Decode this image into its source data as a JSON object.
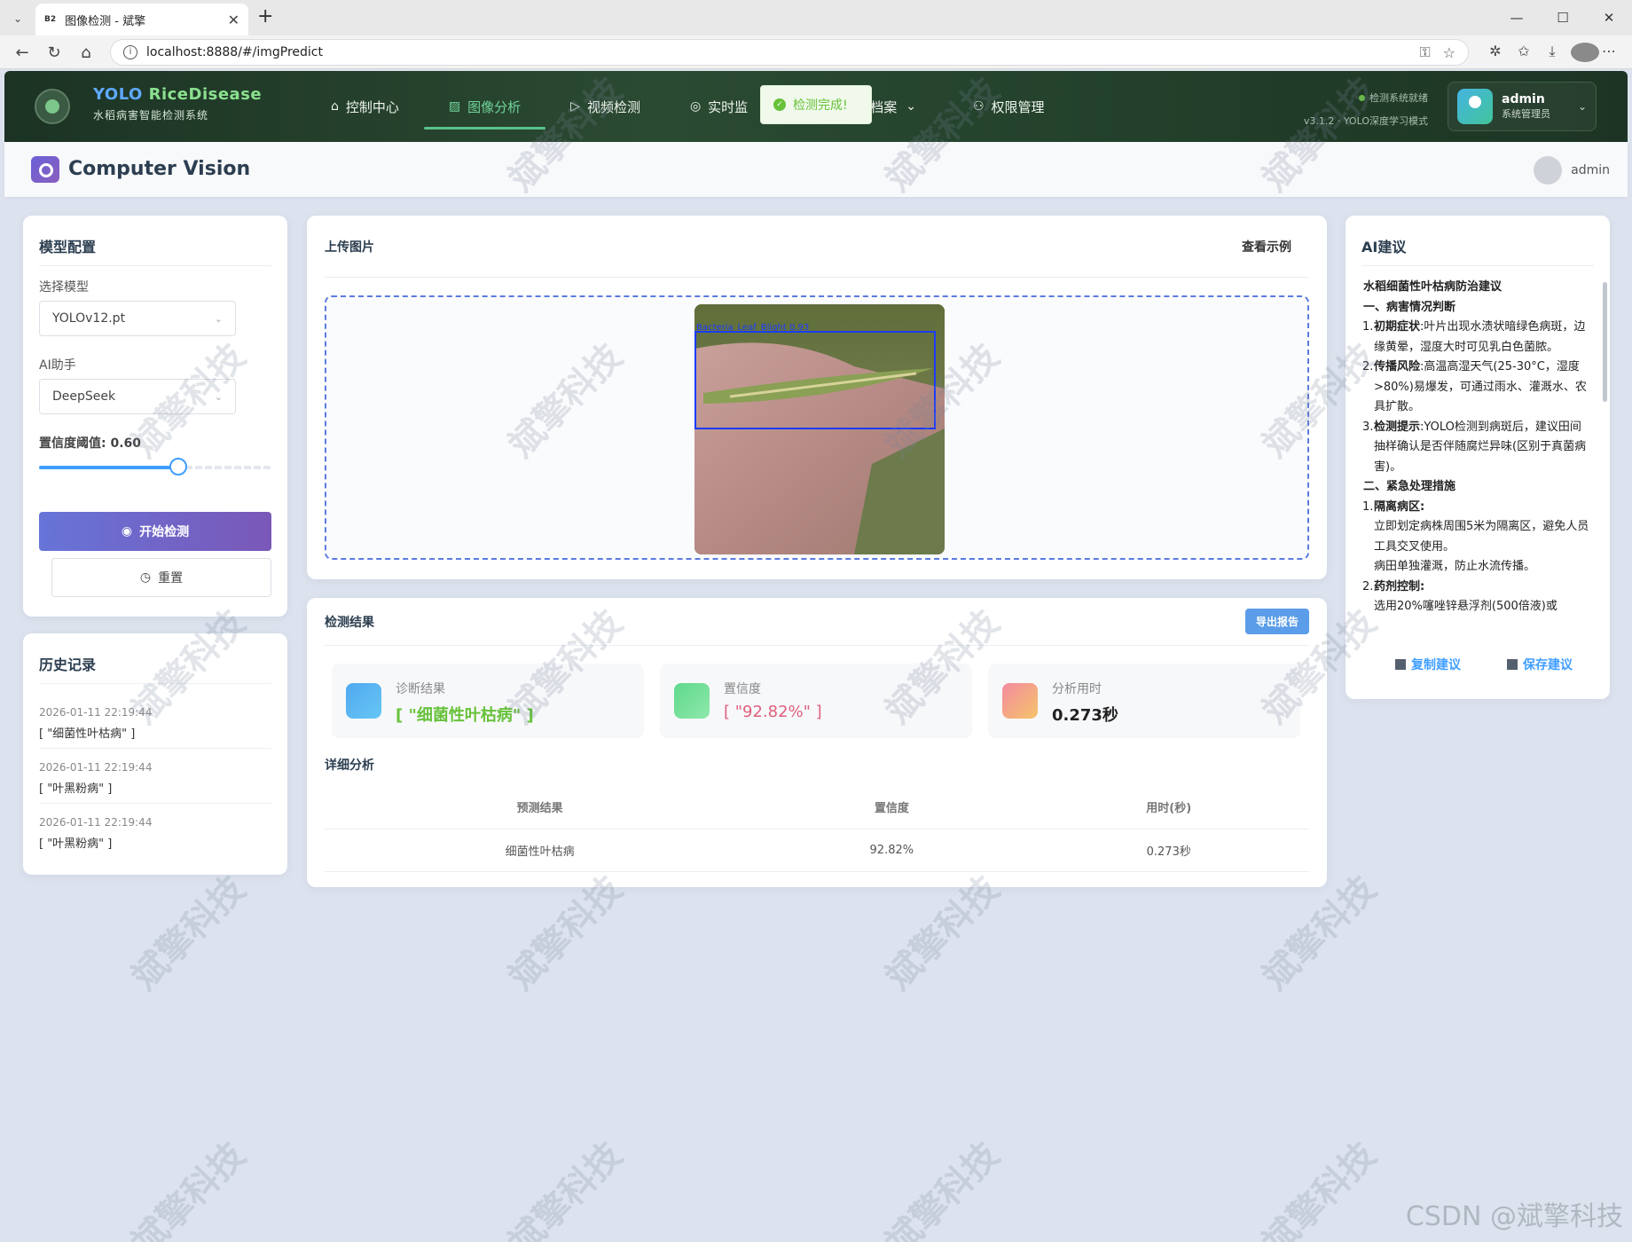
{
  "browser": {
    "tab_title": "图像检测 - 斌擎",
    "tab_favicon": "B2",
    "url": "localhost:8888/#/imgPredict"
  },
  "nav": {
    "brand_yolo": "YOLO",
    "brand_rice": "RiceDisease",
    "brand_sub": "水稻病害智能检测系统",
    "items": [
      {
        "label": "控制中心",
        "icon": "home-icon"
      },
      {
        "label": "图像分析",
        "icon": "image-icon"
      },
      {
        "label": "视频检测",
        "icon": "play-icon"
      },
      {
        "label": "实时监",
        "icon": "camera-icon"
      },
      {
        "label": "档案",
        "icon": "chevron-down-icon"
      },
      {
        "label": "权限管理",
        "icon": "user-icon"
      }
    ],
    "status": "检测系统就绪",
    "version": "v3.1.2 · YOLO深度学习模式",
    "user_name": "admin",
    "user_role": "系统管理员"
  },
  "toast": "检测完成!",
  "subheader": {
    "title": "Computer Vision",
    "user": "admin"
  },
  "model_config": {
    "title": "模型配置",
    "model_label": "选择模型",
    "model_value": "YOLOv12.pt",
    "ai_label": "AI助手",
    "ai_value": "DeepSeek",
    "threshold_label": "置信度阈值: 0.60",
    "threshold_value": 0.6,
    "start_button": "开始检测",
    "reset_button": "重置"
  },
  "history": {
    "title": "历史记录",
    "items": [
      {
        "time": "2026-01-11 22:19:44",
        "value": "[ \"细菌性叶枯病\" ]"
      },
      {
        "time": "2026-01-11 22:19:44",
        "value": "[ \"叶黑粉病\" ]"
      },
      {
        "time": "2026-01-11 22:19:44",
        "value": "[ \"叶黑粉病\" ]"
      }
    ]
  },
  "upload": {
    "title": "上传图片",
    "example_button": "查看示例",
    "detection_label": "Bacteria_Leaf_Blight 0.93"
  },
  "results": {
    "title": "检测结果",
    "export_button": "导出报告",
    "diag_label": "诊断结果",
    "diag_value": "[ \"细菌性叶枯病\" ]",
    "conf_label": "置信度",
    "conf_value": "[ \"92.82%\" ]",
    "time_label": "分析用时",
    "time_value": "0.273秒",
    "detail_title": "详细分析",
    "columns": [
      "预测结果",
      "置信度",
      "用时(秒)"
    ],
    "rows": [
      [
        "细菌性叶枯病",
        "92.82%",
        "0.273秒"
      ]
    ]
  },
  "ai": {
    "title": "AI建议",
    "heading": "水稻细菌性叶枯病防治建议",
    "section1": "一、病害情况判断",
    "p1_b": "初期症状",
    "p1": ":叶片出现水渍状暗绿色病斑，边缘黄晕，湿度大时可见乳白色菌脓。",
    "p2_b": "传播风险",
    "p2": ":高温高湿天气(25-30°C，湿度>80%)易爆发，可通过雨水、灌溉水、农具扩散。",
    "p3_b": "检测提示",
    "p3": ":YOLO检测到病斑后，建议田间抽样确认是否伴随腐烂异味(区别于真菌病害)。",
    "section2": "二、紧急处理措施",
    "q1_b": "隔离病区",
    "q1": "立即划定病株周围5米为隔离区，避免人员工具交叉使用。",
    "q1b": "病田单独灌溉，防止水流传播。",
    "q2_b": "药剂控制",
    "q2": "选用20%噻唑锌悬浮剂(500倍液)或",
    "copy_button": "复制建议",
    "save_button": "保存建议"
  },
  "watermark": "斌擎科技",
  "footer_mark": "CSDN @斌擎科技",
  "colors": {
    "accent": "#409eff",
    "nav_active": "#6fd49a",
    "diag": "#67c23a",
    "conf": "#e0607e"
  }
}
